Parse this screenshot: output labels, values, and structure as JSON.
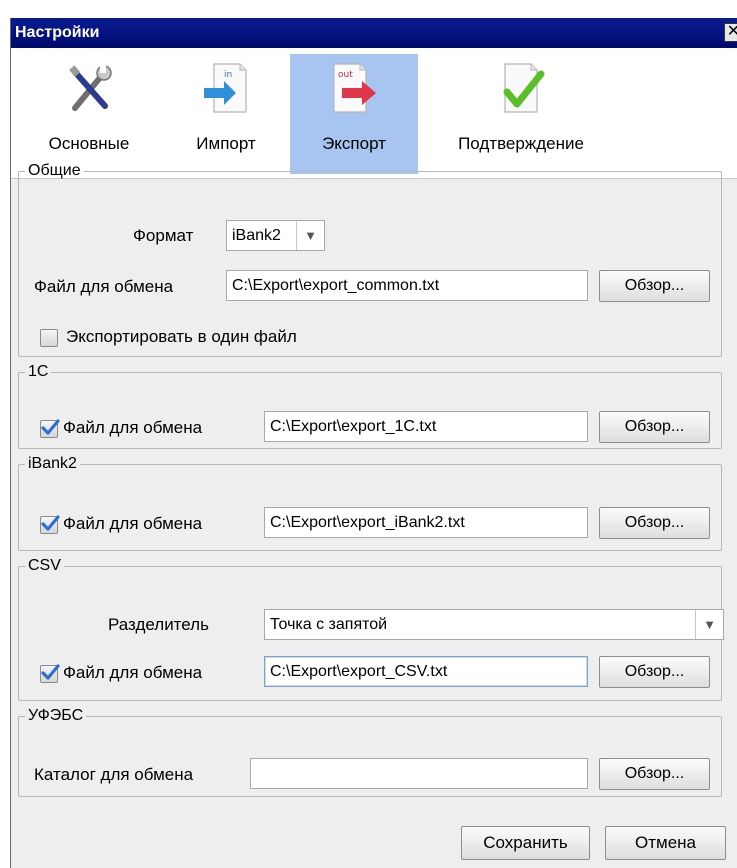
{
  "window": {
    "title": "Настройки",
    "close_glyph": "✕"
  },
  "tabs": [
    {
      "label": "Основные",
      "icon": "tools-icon",
      "active": false
    },
    {
      "label": "Импорт",
      "icon": "import-icon",
      "badge": "in",
      "active": false
    },
    {
      "label": "Экспорт",
      "icon": "export-icon",
      "badge": "out",
      "active": true
    },
    {
      "label": "Подтверждение",
      "icon": "confirm-check-icon",
      "active": false
    }
  ],
  "general": {
    "legend": "Общие",
    "format_label": "Формат",
    "format_value": "iBank2",
    "file_label": "Файл для обмена",
    "file_value": "C:\\Export\\export_common.txt",
    "browse": "Обзор...",
    "single_file_label": "Экспортировать в один файл",
    "single_file_checked": false
  },
  "onec": {
    "legend": "1C",
    "file_label": "Файл для обмена",
    "file_checked": true,
    "file_value": "C:\\Export\\export_1C.txt",
    "browse": "Обзор..."
  },
  "ibank2": {
    "legend": "iBank2",
    "file_label": "Файл для обмена",
    "file_checked": true,
    "file_value": "C:\\Export\\export_iBank2.txt",
    "browse": "Обзор..."
  },
  "csv": {
    "legend": "CSV",
    "separator_label": "Разделитель",
    "separator_value": "Точка с запятой",
    "file_label": "Файл для обмена",
    "file_checked": true,
    "file_value": "C:\\Export\\export_CSV.txt",
    "browse": "Обзор..."
  },
  "ufebs": {
    "legend": "УФЭБС",
    "dir_label": "Каталог для обмена",
    "dir_value": "",
    "browse": "Обзор..."
  },
  "footer": {
    "save": "Сохранить",
    "cancel": "Отмена"
  },
  "colors": {
    "title_bar": "#0b1c92",
    "active_tab": "#a8c4f0",
    "check": "#2a6fd6",
    "export_arrow": "#e0364a",
    "import_arrow": "#2f8fd8",
    "confirm_check": "#5cbf2a"
  }
}
